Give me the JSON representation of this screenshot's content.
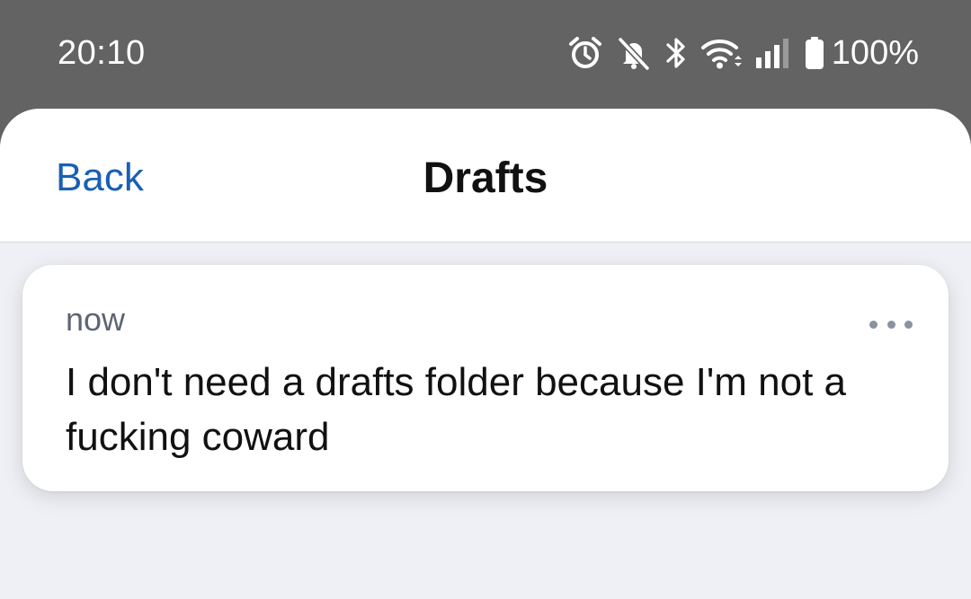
{
  "status_bar": {
    "time": "20:10",
    "battery_percent": "100%",
    "icons": [
      "alarm-icon",
      "notifications-off-icon",
      "bluetooth-icon",
      "wifi-icon",
      "signal-icon",
      "battery-icon"
    ]
  },
  "header": {
    "back_label": "Back",
    "title": "Drafts"
  },
  "drafts": [
    {
      "time": "now",
      "text": "I don't need a drafts folder because I'm not a fucking coward"
    }
  ],
  "colors": {
    "accent": "#1a5fb4",
    "status_bar_bg": "#636363",
    "sheet_bg": "#eff0f5"
  }
}
